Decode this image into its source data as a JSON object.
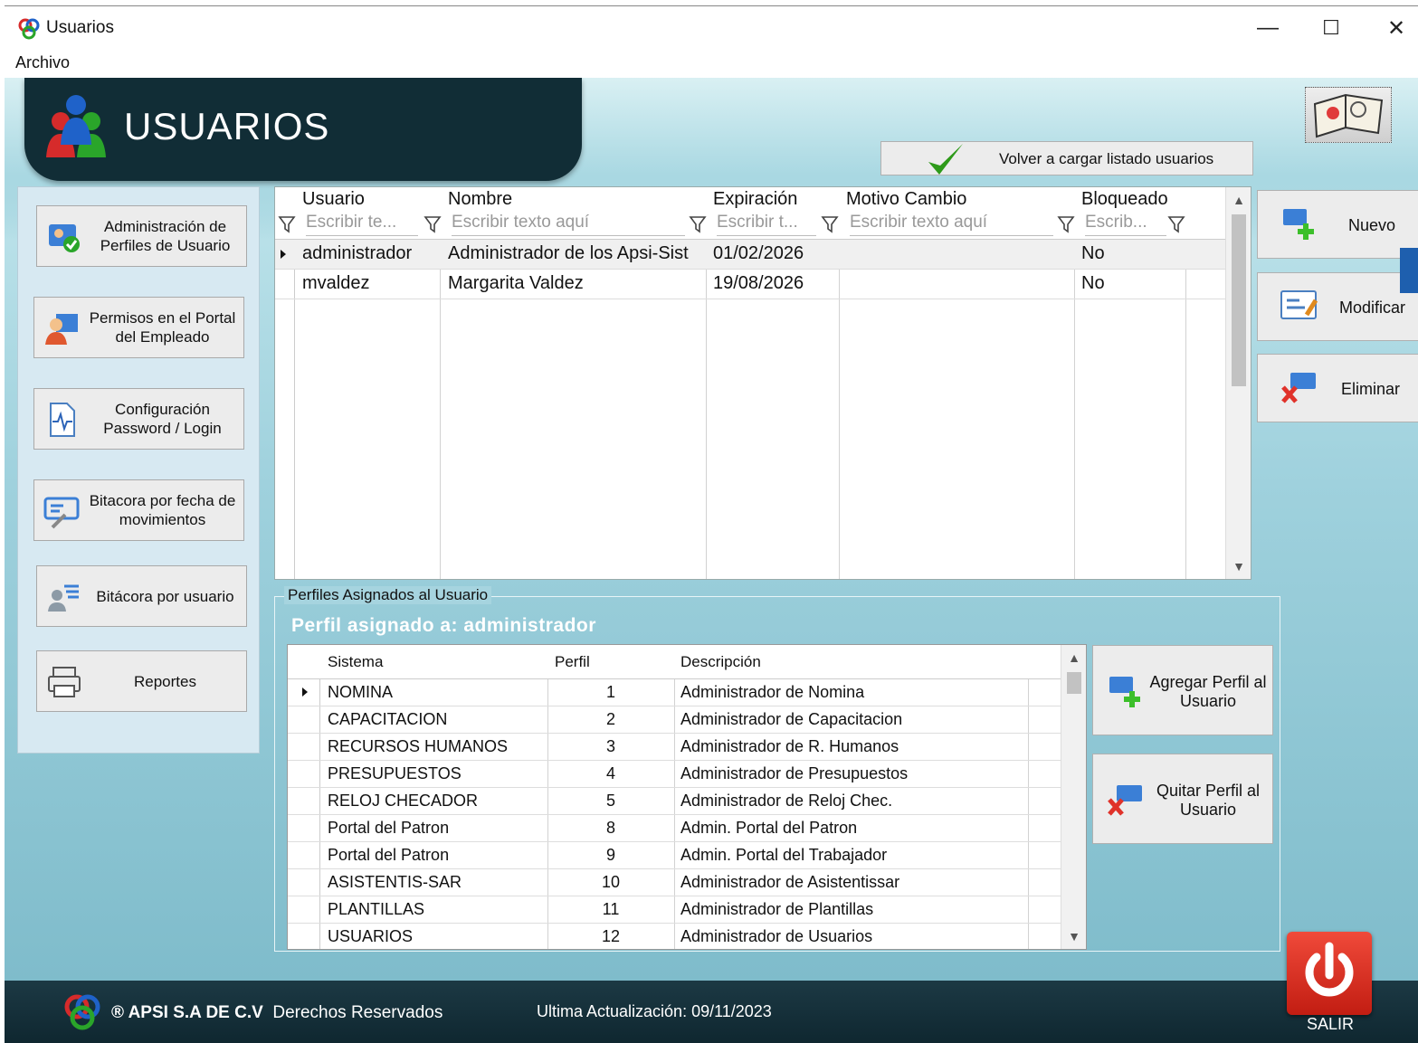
{
  "window": {
    "title": "Usuarios",
    "minimize": "—",
    "maximize": "☐",
    "close": "✕"
  },
  "menu": {
    "archivo": "Archivo"
  },
  "header": {
    "title": "USUARIOS"
  },
  "toolbar": {
    "reload_label": "Volver a cargar listado usuarios"
  },
  "nav": [
    {
      "label": "Administración de Perfiles de Usuario",
      "icon": "profile-admin-icon"
    },
    {
      "label": "Permisos en el Portal del Empleado",
      "icon": "employee-portal-icon"
    },
    {
      "label": "Configuración Password / Login",
      "icon": "password-config-icon"
    },
    {
      "label": "Bitacora por fecha de movimientos",
      "icon": "log-by-date-icon"
    },
    {
      "label": "Bitácora por usuario",
      "icon": "log-by-user-icon"
    },
    {
      "label": "Reportes",
      "icon": "printer-icon"
    }
  ],
  "users_grid": {
    "columns": [
      "Usuario",
      "Nombre",
      "Expiración",
      "Motivo Cambio",
      "Bloqueado"
    ],
    "filters": [
      "Escribir te...",
      "Escribir texto aquí",
      "Escribir t...",
      "Escribir texto aquí",
      "Escrib..."
    ],
    "rows": [
      {
        "usuario": "administrador",
        "nombre": "Administrador de los Apsi-Sist",
        "expiracion": "01/02/2026",
        "motivo": "",
        "bloqueado": "No"
      },
      {
        "usuario": "mvaldez",
        "nombre": "Margarita Valdez",
        "expiracion": "19/08/2026",
        "motivo": "",
        "bloqueado": "No"
      }
    ]
  },
  "actions": {
    "nuevo": "Nuevo",
    "modificar": "Modificar",
    "eliminar": "Eliminar"
  },
  "profiles": {
    "legend": "Perfiles Asignados al Usuario",
    "assigned_to": "Perfil asignado a: administrador",
    "columns": [
      "Sistema",
      "Perfil",
      "Descripción"
    ],
    "rows": [
      {
        "sistema": "NOMINA",
        "perfil": "1",
        "descripcion": "Administrador de Nomina"
      },
      {
        "sistema": "CAPACITACION",
        "perfil": "2",
        "descripcion": "Administrador de Capacitacion"
      },
      {
        "sistema": "RECURSOS HUMANOS",
        "perfil": "3",
        "descripcion": "Administrador de R. Humanos"
      },
      {
        "sistema": "PRESUPUESTOS",
        "perfil": "4",
        "descripcion": "Administrador de Presupuestos"
      },
      {
        "sistema": "RELOJ CHECADOR",
        "perfil": "5",
        "descripcion": "Administrador de Reloj Chec."
      },
      {
        "sistema": "Portal del Patron",
        "perfil": "8",
        "descripcion": "Admin. Portal del Patron"
      },
      {
        "sistema": "Portal del Patron",
        "perfil": "9",
        "descripcion": "Admin. Portal del Trabajador"
      },
      {
        "sistema": "ASISTENTIS-SAR",
        "perfil": "10",
        "descripcion": "Administrador de Asistentissar"
      },
      {
        "sistema": "PLANTILLAS",
        "perfil": "11",
        "descripcion": "Administrador de Plantillas"
      },
      {
        "sistema": "USUARIOS",
        "perfil": "12",
        "descripcion": "Administrador de Usuarios"
      }
    ],
    "add_label": "Agregar Perfil al Usuario",
    "remove_label": "Quitar Perfil al Usuario"
  },
  "footer": {
    "company": "® APSI S.A DE C.V",
    "rights": "Derechos Reservados",
    "updated": "Ultima Actualización: 09/11/2023",
    "salir": "SALIR"
  },
  "colors": {
    "header_dark": "#112d36",
    "accent_blue": "#1e5fae",
    "exit_red": "#d9281c",
    "check_green": "#2e9a1a"
  }
}
